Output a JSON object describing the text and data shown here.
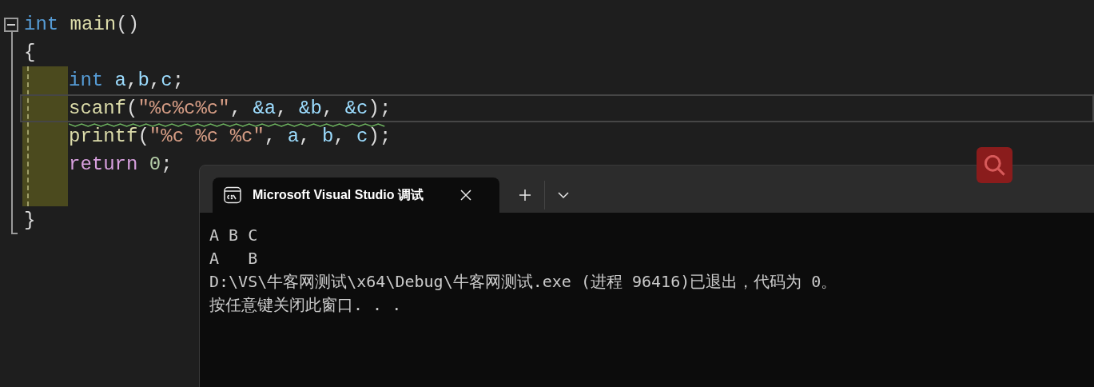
{
  "editor": {
    "fold": {
      "expanded": true
    },
    "lines": [
      {
        "tokens": [
          {
            "kind": "keyword",
            "text": "int"
          },
          {
            "kind": "function",
            "text": " main"
          },
          {
            "kind": "plain",
            "text": "()"
          }
        ]
      },
      {
        "tokens": [
          {
            "kind": "plain",
            "text": "{"
          }
        ]
      },
      {
        "children": [
          {
            "current": false,
            "warning": false,
            "tokens": [
              {
                "kind": "keyword",
                "text": "int"
              },
              {
                "kind": "variable",
                "text": " a"
              },
              {
                "kind": "plain",
                "text": ","
              },
              {
                "kind": "variable",
                "text": "b"
              },
              {
                "kind": "plain",
                "text": ","
              },
              {
                "kind": "variable",
                "text": "c"
              },
              {
                "kind": "plain",
                "text": ";"
              }
            ]
          },
          {
            "current": true,
            "warning": true,
            "tokens": [
              {
                "kind": "function",
                "text": "scanf"
              },
              {
                "kind": "plain",
                "text": "("
              },
              {
                "kind": "string",
                "text": "\"%c%c%c\""
              },
              {
                "kind": "plain",
                "text": ","
              },
              {
                "kind": "variable",
                "text": " &a"
              },
              {
                "kind": "plain",
                "text": ","
              },
              {
                "kind": "variable",
                "text": " &b"
              },
              {
                "kind": "plain",
                "text": ","
              },
              {
                "kind": "variable",
                "text": " &c"
              },
              {
                "kind": "plain",
                "text": ");"
              }
            ]
          },
          {
            "current": false,
            "warning": false,
            "tokens": [
              {
                "kind": "function",
                "text": "printf"
              },
              {
                "kind": "plain",
                "text": "("
              },
              {
                "kind": "string",
                "text": "\"%c %c %c\""
              },
              {
                "kind": "plain",
                "text": ","
              },
              {
                "kind": "variable",
                "text": " a"
              },
              {
                "kind": "plain",
                "text": ","
              },
              {
                "kind": "variable",
                "text": " b"
              },
              {
                "kind": "plain",
                "text": ","
              },
              {
                "kind": "variable",
                "text": " c"
              },
              {
                "kind": "plain",
                "text": ");"
              }
            ]
          },
          {
            "current": false,
            "warning": false,
            "tokens": [
              {
                "kind": "control",
                "text": "return"
              },
              {
                "kind": "number",
                "text": " 0"
              },
              {
                "kind": "plain",
                "text": ";"
              }
            ]
          }
        ]
      },
      {
        "tokens": [
          {
            "kind": "plain",
            "text": "}"
          }
        ]
      }
    ]
  },
  "terminal": {
    "tabs": [
      {
        "title": "Microsoft Visual Studio 调试",
        "selected": true
      }
    ],
    "output": [
      "A B C",
      "A   B",
      "D:\\VS\\牛客网测试\\x64\\Debug\\牛客网测试.exe (进程 96416)已退出，代码为 0。",
      "按任意键关闭此窗口. . ."
    ]
  }
}
